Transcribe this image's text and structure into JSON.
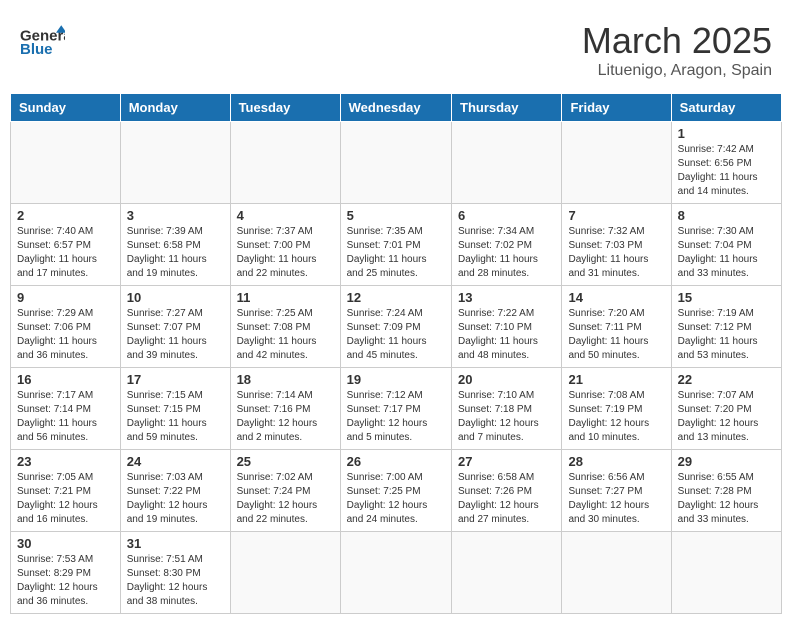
{
  "header": {
    "logo_text_general": "General",
    "logo_text_blue": "Blue",
    "month_title": "March 2025",
    "location": "Lituenigo, Aragon, Spain"
  },
  "weekdays": [
    "Sunday",
    "Monday",
    "Tuesday",
    "Wednesday",
    "Thursday",
    "Friday",
    "Saturday"
  ],
  "weeks": [
    [
      {
        "day": "",
        "info": ""
      },
      {
        "day": "",
        "info": ""
      },
      {
        "day": "",
        "info": ""
      },
      {
        "day": "",
        "info": ""
      },
      {
        "day": "",
        "info": ""
      },
      {
        "day": "",
        "info": ""
      },
      {
        "day": "1",
        "info": "Sunrise: 7:42 AM\nSunset: 6:56 PM\nDaylight: 11 hours and 14 minutes."
      }
    ],
    [
      {
        "day": "2",
        "info": "Sunrise: 7:40 AM\nSunset: 6:57 PM\nDaylight: 11 hours and 17 minutes."
      },
      {
        "day": "3",
        "info": "Sunrise: 7:39 AM\nSunset: 6:58 PM\nDaylight: 11 hours and 19 minutes."
      },
      {
        "day": "4",
        "info": "Sunrise: 7:37 AM\nSunset: 7:00 PM\nDaylight: 11 hours and 22 minutes."
      },
      {
        "day": "5",
        "info": "Sunrise: 7:35 AM\nSunset: 7:01 PM\nDaylight: 11 hours and 25 minutes."
      },
      {
        "day": "6",
        "info": "Sunrise: 7:34 AM\nSunset: 7:02 PM\nDaylight: 11 hours and 28 minutes."
      },
      {
        "day": "7",
        "info": "Sunrise: 7:32 AM\nSunset: 7:03 PM\nDaylight: 11 hours and 31 minutes."
      },
      {
        "day": "8",
        "info": "Sunrise: 7:30 AM\nSunset: 7:04 PM\nDaylight: 11 hours and 33 minutes."
      }
    ],
    [
      {
        "day": "9",
        "info": "Sunrise: 7:29 AM\nSunset: 7:06 PM\nDaylight: 11 hours and 36 minutes."
      },
      {
        "day": "10",
        "info": "Sunrise: 7:27 AM\nSunset: 7:07 PM\nDaylight: 11 hours and 39 minutes."
      },
      {
        "day": "11",
        "info": "Sunrise: 7:25 AM\nSunset: 7:08 PM\nDaylight: 11 hours and 42 minutes."
      },
      {
        "day": "12",
        "info": "Sunrise: 7:24 AM\nSunset: 7:09 PM\nDaylight: 11 hours and 45 minutes."
      },
      {
        "day": "13",
        "info": "Sunrise: 7:22 AM\nSunset: 7:10 PM\nDaylight: 11 hours and 48 minutes."
      },
      {
        "day": "14",
        "info": "Sunrise: 7:20 AM\nSunset: 7:11 PM\nDaylight: 11 hours and 50 minutes."
      },
      {
        "day": "15",
        "info": "Sunrise: 7:19 AM\nSunset: 7:12 PM\nDaylight: 11 hours and 53 minutes."
      }
    ],
    [
      {
        "day": "16",
        "info": "Sunrise: 7:17 AM\nSunset: 7:14 PM\nDaylight: 11 hours and 56 minutes."
      },
      {
        "day": "17",
        "info": "Sunrise: 7:15 AM\nSunset: 7:15 PM\nDaylight: 11 hours and 59 minutes."
      },
      {
        "day": "18",
        "info": "Sunrise: 7:14 AM\nSunset: 7:16 PM\nDaylight: 12 hours and 2 minutes."
      },
      {
        "day": "19",
        "info": "Sunrise: 7:12 AM\nSunset: 7:17 PM\nDaylight: 12 hours and 5 minutes."
      },
      {
        "day": "20",
        "info": "Sunrise: 7:10 AM\nSunset: 7:18 PM\nDaylight: 12 hours and 7 minutes."
      },
      {
        "day": "21",
        "info": "Sunrise: 7:08 AM\nSunset: 7:19 PM\nDaylight: 12 hours and 10 minutes."
      },
      {
        "day": "22",
        "info": "Sunrise: 7:07 AM\nSunset: 7:20 PM\nDaylight: 12 hours and 13 minutes."
      }
    ],
    [
      {
        "day": "23",
        "info": "Sunrise: 7:05 AM\nSunset: 7:21 PM\nDaylight: 12 hours and 16 minutes."
      },
      {
        "day": "24",
        "info": "Sunrise: 7:03 AM\nSunset: 7:22 PM\nDaylight: 12 hours and 19 minutes."
      },
      {
        "day": "25",
        "info": "Sunrise: 7:02 AM\nSunset: 7:24 PM\nDaylight: 12 hours and 22 minutes."
      },
      {
        "day": "26",
        "info": "Sunrise: 7:00 AM\nSunset: 7:25 PM\nDaylight: 12 hours and 24 minutes."
      },
      {
        "day": "27",
        "info": "Sunrise: 6:58 AM\nSunset: 7:26 PM\nDaylight: 12 hours and 27 minutes."
      },
      {
        "day": "28",
        "info": "Sunrise: 6:56 AM\nSunset: 7:27 PM\nDaylight: 12 hours and 30 minutes."
      },
      {
        "day": "29",
        "info": "Sunrise: 6:55 AM\nSunset: 7:28 PM\nDaylight: 12 hours and 33 minutes."
      }
    ],
    [
      {
        "day": "30",
        "info": "Sunrise: 7:53 AM\nSunset: 8:29 PM\nDaylight: 12 hours and 36 minutes."
      },
      {
        "day": "31",
        "info": "Sunrise: 7:51 AM\nSunset: 8:30 PM\nDaylight: 12 hours and 38 minutes."
      },
      {
        "day": "",
        "info": ""
      },
      {
        "day": "",
        "info": ""
      },
      {
        "day": "",
        "info": ""
      },
      {
        "day": "",
        "info": ""
      },
      {
        "day": "",
        "info": ""
      }
    ]
  ]
}
